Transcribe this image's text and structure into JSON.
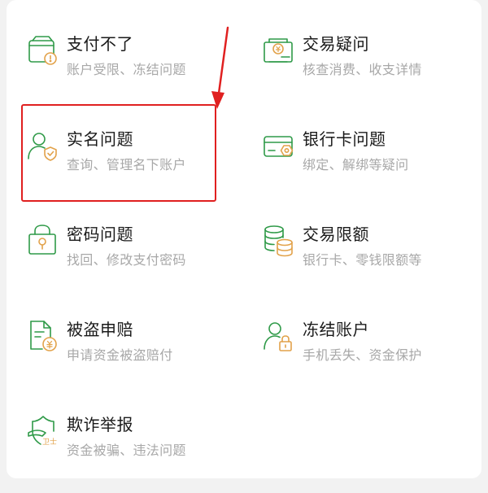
{
  "colors": {
    "green": "#2f9a48",
    "orange": "#e2a24a",
    "title_text": "#1a1a1a",
    "subtitle_text": "#a8a8a8",
    "annotation_red": "#e02020"
  },
  "menu": {
    "items": [
      {
        "title": "支付不了",
        "subtitle": "账户受限、冻结问题",
        "icon": "wallet-alert-icon"
      },
      {
        "title": "交易疑问",
        "subtitle": "核查消费、收支详情",
        "icon": "receipt-coin-icon"
      },
      {
        "title": "实名问题",
        "subtitle": "查询、管理名下账户",
        "icon": "user-shield-icon"
      },
      {
        "title": "银行卡问题",
        "subtitle": "绑定、解绑等疑问",
        "icon": "bank-card-gear-icon"
      },
      {
        "title": "密码问题",
        "subtitle": "找回、修改支付密码",
        "icon": "password-lock-icon"
      },
      {
        "title": "交易限额",
        "subtitle": "银行卡、零钱限额等",
        "icon": "coin-stack-icon"
      },
      {
        "title": "被盗申赔",
        "subtitle": "申请资金被盗赔付",
        "icon": "document-yuan-icon"
      },
      {
        "title": "冻结账户",
        "subtitle": "手机丢失、资金保护",
        "icon": "user-lock-icon"
      },
      {
        "title": "欺诈举报",
        "subtitle": "资金被骗、违法问题",
        "icon": "guard-shield-icon"
      }
    ]
  },
  "annotations": {
    "guard_badge_text": "卫士"
  }
}
